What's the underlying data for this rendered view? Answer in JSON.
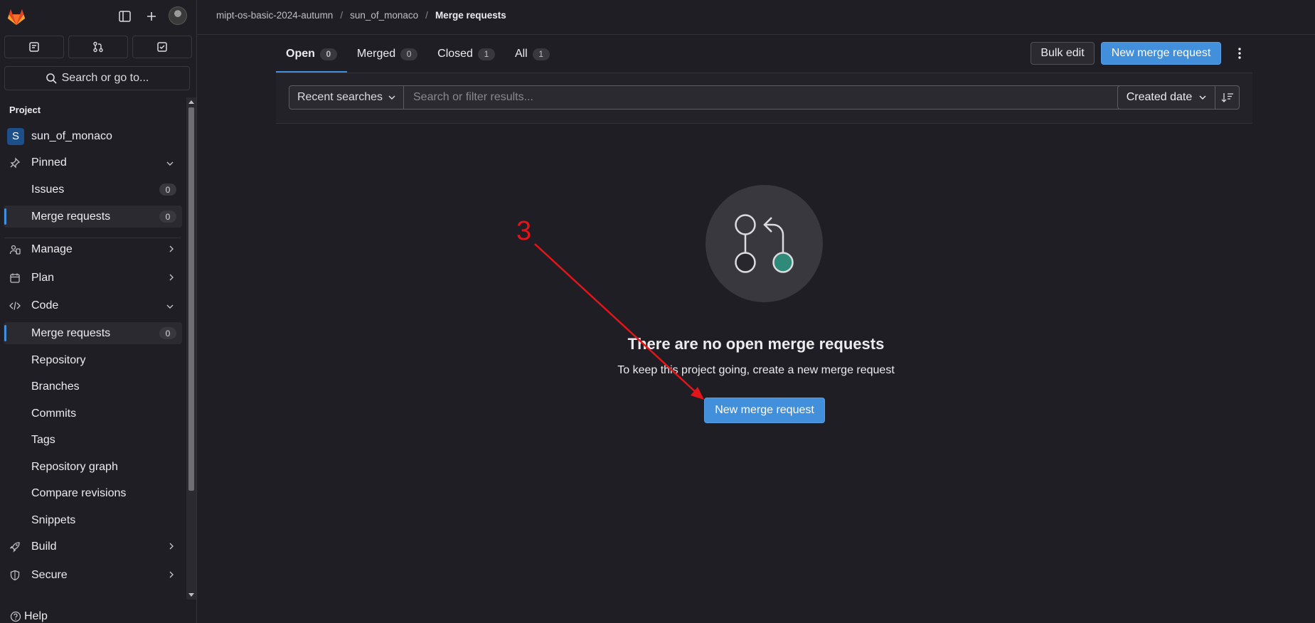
{
  "sidebar": {
    "search_label": "Search or go to...",
    "section_label": "Project",
    "project": {
      "initial": "S",
      "name": "sun_of_monaco"
    },
    "items": [
      {
        "label": "Pinned"
      },
      {
        "label": "Issues",
        "count": "0"
      },
      {
        "label": "Merge requests",
        "count": "0"
      },
      {
        "label": "Manage"
      },
      {
        "label": "Plan"
      },
      {
        "label": "Code"
      },
      {
        "label": "Merge requests",
        "count": "0"
      },
      {
        "label": "Repository"
      },
      {
        "label": "Branches"
      },
      {
        "label": "Commits"
      },
      {
        "label": "Tags"
      },
      {
        "label": "Repository graph"
      },
      {
        "label": "Compare revisions"
      },
      {
        "label": "Snippets"
      },
      {
        "label": "Build"
      },
      {
        "label": "Secure"
      }
    ],
    "help_label": "Help"
  },
  "breadcrumb": [
    "mipt-os-basic-2024-autumn",
    "sun_of_monaco",
    "Merge requests"
  ],
  "tabs": [
    {
      "label": "Open",
      "count": "0"
    },
    {
      "label": "Merged",
      "count": "0"
    },
    {
      "label": "Closed",
      "count": "1"
    },
    {
      "label": "All",
      "count": "1"
    }
  ],
  "actions": {
    "bulk_edit": "Bulk edit",
    "new_mr": "New merge request"
  },
  "filter": {
    "recent_searches": "Recent searches",
    "placeholder": "Search or filter results...",
    "sort_by": "Created date"
  },
  "empty_state": {
    "title": "There are no open merge requests",
    "text": "To keep this project going, create a new merge request",
    "button": "New merge request"
  },
  "annotation": {
    "number": "3"
  },
  "colors": {
    "accent": "#428fdc",
    "background": "#1f1e24",
    "annotation": "#e3151a",
    "illustration_node": "#2f8a7a"
  },
  "icons": [
    "gitlab-logo-icon",
    "sidebar-toggle-icon",
    "plus-icon",
    "issues-icon",
    "merge-request-icon",
    "todo-icon",
    "search-icon",
    "pin-icon",
    "users-icon",
    "calendar-icon",
    "code-icon",
    "rocket-icon",
    "shield-icon",
    "help-icon",
    "chevron-down-icon",
    "chevron-right-icon",
    "kebab-icon",
    "sort-icon"
  ]
}
